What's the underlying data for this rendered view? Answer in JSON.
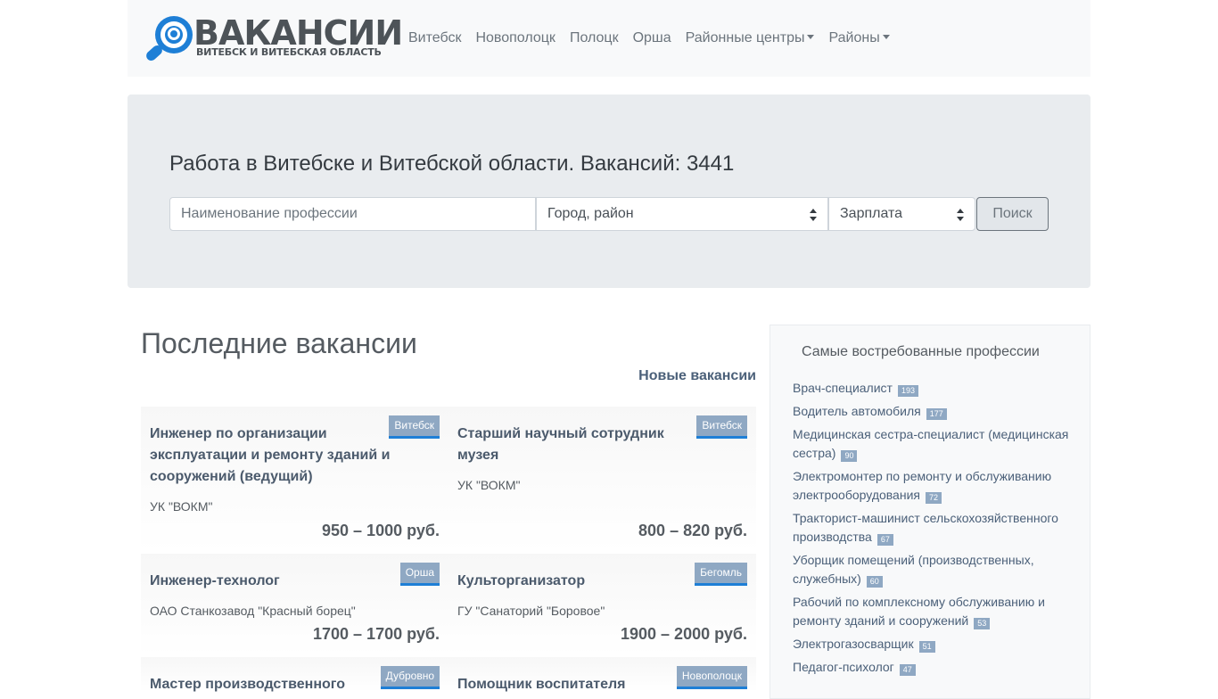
{
  "logo": {
    "word": "ВАКАНСИИ",
    "subtitle": "ВИТЕБСК И ВИТЕБСКАЯ ОБЛАСТЬ"
  },
  "nav": {
    "items": [
      "Витебск",
      "Новополоцк",
      "Полоцк",
      "Орша"
    ],
    "dropdown_regional": "Районные центры",
    "dropdown_districts": "Районы"
  },
  "hero": {
    "title": "Работа в Витебске и Витебской области. Вакансий: 3441",
    "profession_placeholder": "Наименование профессии",
    "city_value": "Город, район",
    "salary_value": "Зарплата",
    "search_button": "Поиск"
  },
  "latest": {
    "title": "Последние вакансии",
    "new_link": "Новые вакансии",
    "cards": [
      {
        "city": "Витебск",
        "title": "Инженер по организации эксплуатации и ремонту зданий и сооружений (ведущий)",
        "org": "УК \"ВОКМ\"",
        "pay": "950 – 1000 руб."
      },
      {
        "city": "Витебск",
        "title": "Старший научный сотрудник музея",
        "org": "УК \"ВОКМ\"",
        "pay": "800 – 820 руб."
      },
      {
        "city": "Орша",
        "title": "Инженер-технолог",
        "org": "ОАО Станкозавод \"Красный борец\"",
        "pay": "1700 – 1700 руб."
      },
      {
        "city": "Бегомль",
        "title": "Культорганизатор",
        "org": "ГУ \"Санаторий \"Боровое\"",
        "pay": "1900 – 2000 руб."
      },
      {
        "city": "Дубровно",
        "title": "Мастер производственного",
        "org": "",
        "pay": ""
      },
      {
        "city": "Новополоцк",
        "title": "Помощник воспитателя",
        "org": "",
        "pay": ""
      }
    ]
  },
  "sidebar": {
    "title": "Самые востребованные профессии",
    "items": [
      {
        "label": "Врач-специалист",
        "count": "193"
      },
      {
        "label": "Водитель автомобиля",
        "count": "177"
      },
      {
        "label": "Медицинская сестра-специалист (медицинская сестра)",
        "count": "90"
      },
      {
        "label": "Электромонтер по ремонту и обслуживанию электрооборудования",
        "count": "72"
      },
      {
        "label": "Тракторист-машинист сельскохозяйственного производства",
        "count": "67"
      },
      {
        "label": "Уборщик помещений (производственных, служебных)",
        "count": "60"
      },
      {
        "label": "Рабочий по комплексному обслуживанию и ремонту зданий и сооружений",
        "count": "53"
      },
      {
        "label": "Электрогазосварщик",
        "count": "51"
      },
      {
        "label": "Педагог-психолог",
        "count": "47"
      }
    ]
  },
  "colors": {
    "brand_blue": "#1e7fd6",
    "badge": "#8fa8c3",
    "link": "#4b6079"
  }
}
